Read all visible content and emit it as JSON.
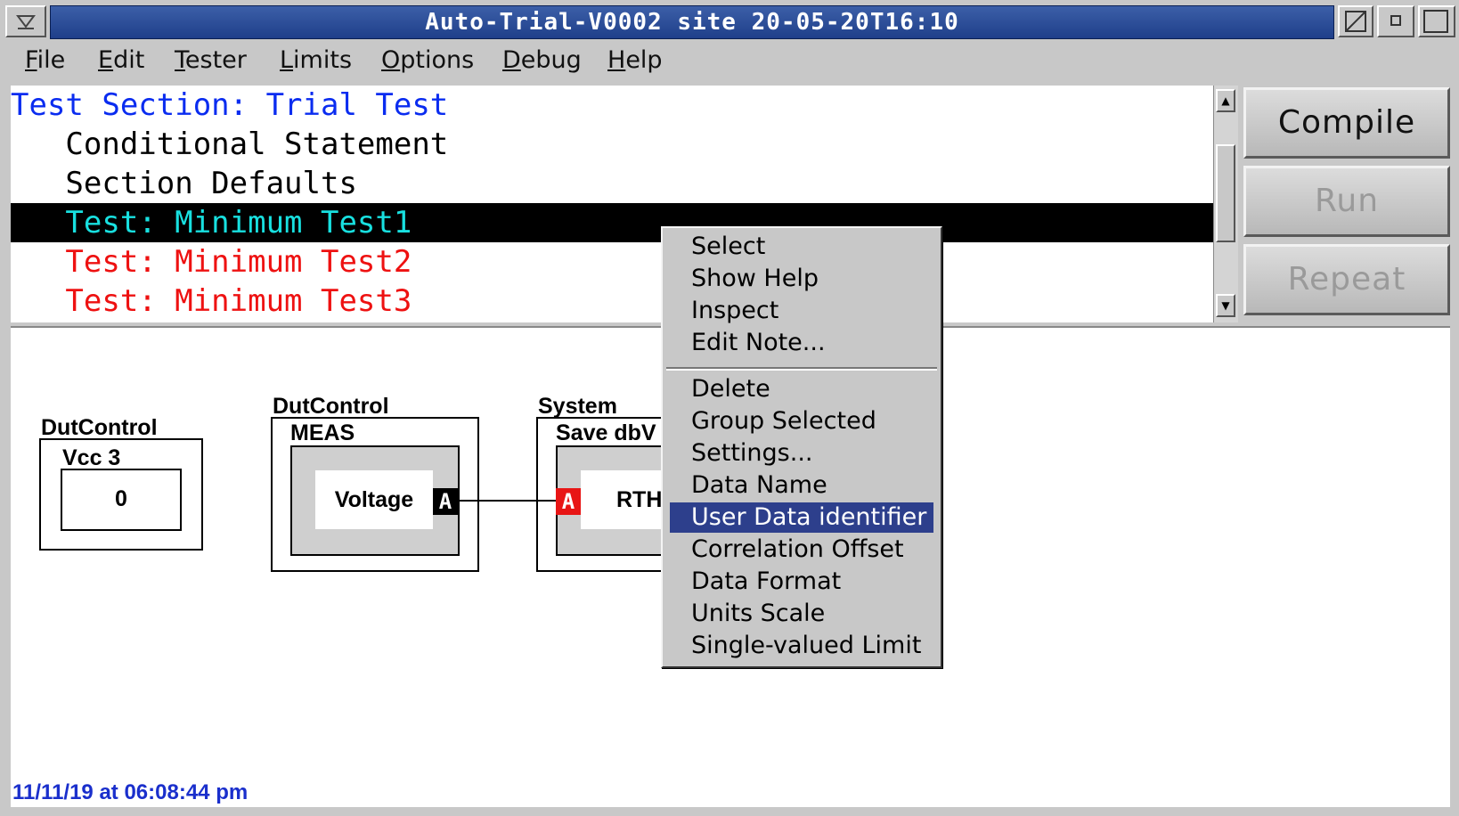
{
  "window": {
    "title": "Auto-Trial-V0002  site  20-05-20T16:10",
    "menu_icon": "chevron-down-icon",
    "controls": [
      "resize-icon",
      "minimize-icon",
      "maximize-icon"
    ]
  },
  "menubar": [
    "File",
    "Edit",
    "Tester",
    "Limits",
    "Options",
    "Debug",
    "Help"
  ],
  "tree": {
    "rows": [
      {
        "label": "Test Section: Trial Test",
        "color": "#0a2cf0"
      },
      {
        "label": "   Conditional Statement",
        "color": "#000000"
      },
      {
        "label": "   Section Defaults",
        "color": "#000000"
      },
      {
        "label": "   Test: Minimum Test1",
        "color": "#18e0e0",
        "selected": true
      },
      {
        "label": "   Test: Minimum Test2",
        "color": "#ee1111"
      },
      {
        "label": "   Test: Minimum Test3",
        "color": "#ee1111"
      }
    ]
  },
  "buttons": {
    "compile": "Compile",
    "run": "Run",
    "repeat": "Repeat"
  },
  "diagram": {
    "block1": {
      "category": "DutControl",
      "name": "Vcc 3",
      "value": "0"
    },
    "block2": {
      "category": "DutControl",
      "name": "MEAS",
      "inner": "Voltage",
      "port": "A"
    },
    "block3": {
      "category": "System",
      "name": "Save dbV",
      "inner": "RTH",
      "port": "A"
    }
  },
  "timestamp": "11/11/19 at 06:08:44 pm",
  "context_menu": {
    "group1": [
      "Select",
      "Show Help",
      "Inspect",
      "Edit Note..."
    ],
    "group2": [
      "Delete",
      "Group Selected",
      "Settings...",
      "Data Name",
      "User Data identifier",
      "Correlation Offset",
      "Data Format",
      "Units Scale",
      "Single-valued Limit"
    ],
    "highlighted": "User Data identifier"
  }
}
